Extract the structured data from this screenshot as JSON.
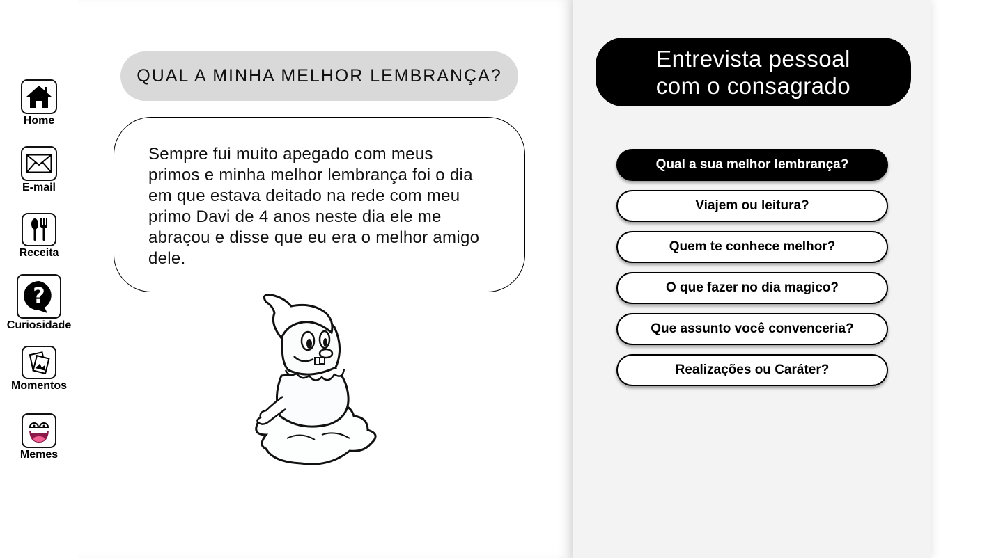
{
  "sidebar": {
    "items": [
      {
        "label": "Home",
        "icon": "home-icon"
      },
      {
        "label": "E-mail",
        "icon": "envelope-icon"
      },
      {
        "label": "Receita",
        "icon": "utensils-icon"
      },
      {
        "label": "Curiosidade",
        "icon": "question-bubble-icon"
      },
      {
        "label": "Momentos",
        "icon": "photos-icon"
      },
      {
        "label": "Memes",
        "icon": "laughing-face-icon"
      }
    ]
  },
  "main": {
    "question": "QUAL A MINHA MELHOR LEMBRANÇA?",
    "answer": "Sempre fui muito apegado com meus primos e minha melhor lembrança foi o dia em que estava deitado na rede com meu primo Davi de 4 anos neste dia ele me abraçou e disse que eu era o melhor amigo dele.",
    "mascot": "cartoon-mascot-illustration"
  },
  "panel": {
    "title_line1": "Entrevista pessoal",
    "title_line2": "com o consagrado",
    "questions": [
      {
        "label": "Qual a sua melhor lembrança?",
        "active": true
      },
      {
        "label": "Viajem ou leitura?",
        "active": false
      },
      {
        "label": "Quem te conhece melhor?",
        "active": false
      },
      {
        "label": "O que fazer no dia magico?",
        "active": false
      },
      {
        "label": "Que assunto você convenceria?",
        "active": false
      },
      {
        "label": "Realizações ou Caráter?",
        "active": false
      }
    ]
  },
  "colors": {
    "accent": "#000000",
    "pill_gray": "#d9d9d9",
    "panel_bg": "#f3f3f3"
  }
}
